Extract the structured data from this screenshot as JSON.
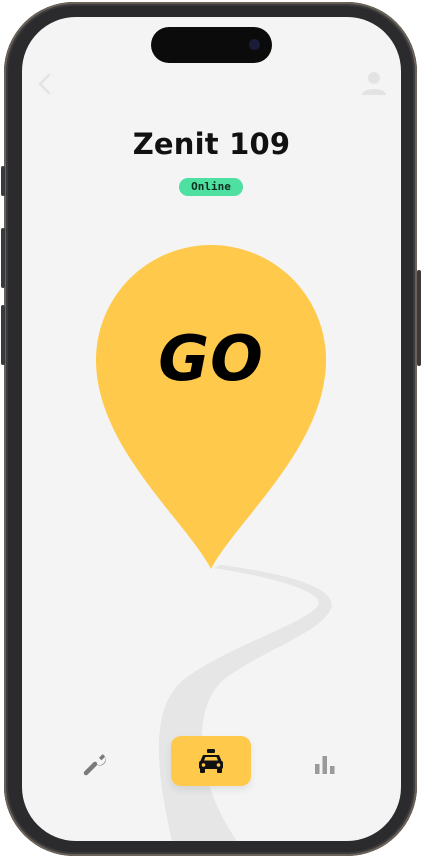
{
  "app": {
    "title": "Zenit 109",
    "status": "Online"
  },
  "main": {
    "go_label": "GO"
  },
  "nav": {
    "back_icon": "chevron-left-icon",
    "profile_icon": "user-icon",
    "tabs": [
      {
        "icon": "wrench-icon",
        "active": false
      },
      {
        "icon": "taxi-icon",
        "active": true
      },
      {
        "icon": "bar-chart-icon",
        "active": false
      }
    ]
  },
  "colors": {
    "accent": "#ffc94c",
    "status": "#4ee0a0",
    "background": "#f4f4f4",
    "road": "#e6e6e6"
  }
}
